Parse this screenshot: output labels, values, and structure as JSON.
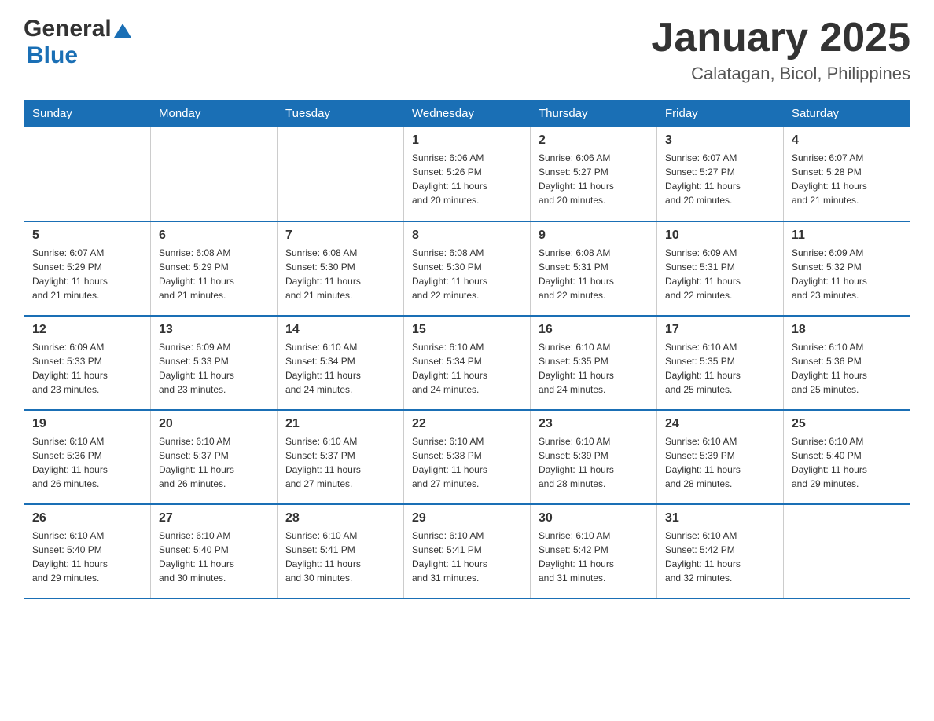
{
  "header": {
    "logo_general": "General",
    "logo_blue": "Blue",
    "title": "January 2025",
    "subtitle": "Calatagan, Bicol, Philippines"
  },
  "days_of_week": [
    "Sunday",
    "Monday",
    "Tuesday",
    "Wednesday",
    "Thursday",
    "Friday",
    "Saturday"
  ],
  "weeks": [
    [
      {
        "day": "",
        "info": ""
      },
      {
        "day": "",
        "info": ""
      },
      {
        "day": "",
        "info": ""
      },
      {
        "day": "1",
        "info": "Sunrise: 6:06 AM\nSunset: 5:26 PM\nDaylight: 11 hours\nand 20 minutes."
      },
      {
        "day": "2",
        "info": "Sunrise: 6:06 AM\nSunset: 5:27 PM\nDaylight: 11 hours\nand 20 minutes."
      },
      {
        "day": "3",
        "info": "Sunrise: 6:07 AM\nSunset: 5:27 PM\nDaylight: 11 hours\nand 20 minutes."
      },
      {
        "day": "4",
        "info": "Sunrise: 6:07 AM\nSunset: 5:28 PM\nDaylight: 11 hours\nand 21 minutes."
      }
    ],
    [
      {
        "day": "5",
        "info": "Sunrise: 6:07 AM\nSunset: 5:29 PM\nDaylight: 11 hours\nand 21 minutes."
      },
      {
        "day": "6",
        "info": "Sunrise: 6:08 AM\nSunset: 5:29 PM\nDaylight: 11 hours\nand 21 minutes."
      },
      {
        "day": "7",
        "info": "Sunrise: 6:08 AM\nSunset: 5:30 PM\nDaylight: 11 hours\nand 21 minutes."
      },
      {
        "day": "8",
        "info": "Sunrise: 6:08 AM\nSunset: 5:30 PM\nDaylight: 11 hours\nand 22 minutes."
      },
      {
        "day": "9",
        "info": "Sunrise: 6:08 AM\nSunset: 5:31 PM\nDaylight: 11 hours\nand 22 minutes."
      },
      {
        "day": "10",
        "info": "Sunrise: 6:09 AM\nSunset: 5:31 PM\nDaylight: 11 hours\nand 22 minutes."
      },
      {
        "day": "11",
        "info": "Sunrise: 6:09 AM\nSunset: 5:32 PM\nDaylight: 11 hours\nand 23 minutes."
      }
    ],
    [
      {
        "day": "12",
        "info": "Sunrise: 6:09 AM\nSunset: 5:33 PM\nDaylight: 11 hours\nand 23 minutes."
      },
      {
        "day": "13",
        "info": "Sunrise: 6:09 AM\nSunset: 5:33 PM\nDaylight: 11 hours\nand 23 minutes."
      },
      {
        "day": "14",
        "info": "Sunrise: 6:10 AM\nSunset: 5:34 PM\nDaylight: 11 hours\nand 24 minutes."
      },
      {
        "day": "15",
        "info": "Sunrise: 6:10 AM\nSunset: 5:34 PM\nDaylight: 11 hours\nand 24 minutes."
      },
      {
        "day": "16",
        "info": "Sunrise: 6:10 AM\nSunset: 5:35 PM\nDaylight: 11 hours\nand 24 minutes."
      },
      {
        "day": "17",
        "info": "Sunrise: 6:10 AM\nSunset: 5:35 PM\nDaylight: 11 hours\nand 25 minutes."
      },
      {
        "day": "18",
        "info": "Sunrise: 6:10 AM\nSunset: 5:36 PM\nDaylight: 11 hours\nand 25 minutes."
      }
    ],
    [
      {
        "day": "19",
        "info": "Sunrise: 6:10 AM\nSunset: 5:36 PM\nDaylight: 11 hours\nand 26 minutes."
      },
      {
        "day": "20",
        "info": "Sunrise: 6:10 AM\nSunset: 5:37 PM\nDaylight: 11 hours\nand 26 minutes."
      },
      {
        "day": "21",
        "info": "Sunrise: 6:10 AM\nSunset: 5:37 PM\nDaylight: 11 hours\nand 27 minutes."
      },
      {
        "day": "22",
        "info": "Sunrise: 6:10 AM\nSunset: 5:38 PM\nDaylight: 11 hours\nand 27 minutes."
      },
      {
        "day": "23",
        "info": "Sunrise: 6:10 AM\nSunset: 5:39 PM\nDaylight: 11 hours\nand 28 minutes."
      },
      {
        "day": "24",
        "info": "Sunrise: 6:10 AM\nSunset: 5:39 PM\nDaylight: 11 hours\nand 28 minutes."
      },
      {
        "day": "25",
        "info": "Sunrise: 6:10 AM\nSunset: 5:40 PM\nDaylight: 11 hours\nand 29 minutes."
      }
    ],
    [
      {
        "day": "26",
        "info": "Sunrise: 6:10 AM\nSunset: 5:40 PM\nDaylight: 11 hours\nand 29 minutes."
      },
      {
        "day": "27",
        "info": "Sunrise: 6:10 AM\nSunset: 5:40 PM\nDaylight: 11 hours\nand 30 minutes."
      },
      {
        "day": "28",
        "info": "Sunrise: 6:10 AM\nSunset: 5:41 PM\nDaylight: 11 hours\nand 30 minutes."
      },
      {
        "day": "29",
        "info": "Sunrise: 6:10 AM\nSunset: 5:41 PM\nDaylight: 11 hours\nand 31 minutes."
      },
      {
        "day": "30",
        "info": "Sunrise: 6:10 AM\nSunset: 5:42 PM\nDaylight: 11 hours\nand 31 minutes."
      },
      {
        "day": "31",
        "info": "Sunrise: 6:10 AM\nSunset: 5:42 PM\nDaylight: 11 hours\nand 32 minutes."
      },
      {
        "day": "",
        "info": ""
      }
    ]
  ]
}
